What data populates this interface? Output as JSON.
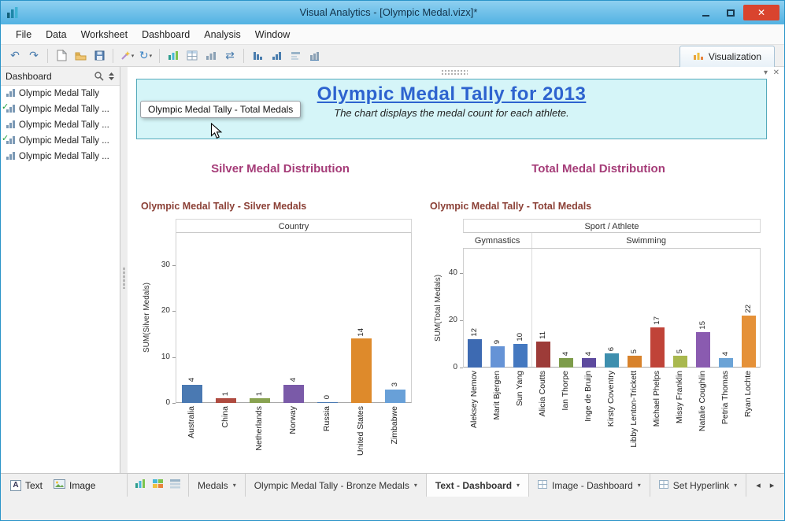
{
  "window": {
    "title": "Visual Analytics - [Olympic Medal.vizx]*"
  },
  "menubar": {
    "items": [
      "File",
      "Data",
      "Worksheet",
      "Dashboard",
      "Analysis",
      "Window"
    ]
  },
  "toolbar": {
    "visualization_tab": "Visualization"
  },
  "sidebar": {
    "header": "Dashboard",
    "items": [
      {
        "label": "Olympic Medal Tally",
        "checked": false
      },
      {
        "label": "Olympic Medal Tally ...",
        "checked": true
      },
      {
        "label": "Olympic Medal Tally ...",
        "checked": false
      },
      {
        "label": "Olympic Medal Tally ...",
        "checked": true
      },
      {
        "label": "Olympic Medal Tally ...",
        "checked": false
      }
    ],
    "footer": {
      "text": "Text",
      "image": "Image"
    }
  },
  "banner": {
    "title": "Olympic Medal Tally for 2013",
    "subtitle": "The chart displays the medal count for each athlete."
  },
  "tooltip": {
    "text": "Olympic Medal Tally - Total Medals"
  },
  "sections": {
    "left_heading": "Silver Medal Distribution",
    "right_heading": "Total Medal Distribution"
  },
  "chart_data": [
    {
      "type": "bar",
      "title": "Olympic Medal Tally - Silver Medals",
      "column_header": "Country",
      "ylabel": "SUM(Silver Medals)",
      "yticks": [
        0,
        10,
        20,
        30
      ],
      "ylim": [
        0,
        37
      ],
      "categories": [
        "Australia",
        "China",
        "Netherlands",
        "Norway",
        "Russia",
        "United States",
        "Zimbabwe"
      ],
      "values": [
        4,
        1,
        1,
        4,
        0,
        14,
        3
      ],
      "bar_colors": [
        "#4a79b2",
        "#af4b40",
        "#89a351",
        "#7a5aa8",
        "#4a79b2",
        "#de8a2b",
        "#68a0d8"
      ],
      "show_value_labels": true,
      "grid": false,
      "legend": "none"
    },
    {
      "type": "bar",
      "title": "Olympic Medal Tally - Total Medals",
      "column_header": "Sport / Athlete",
      "groups": [
        {
          "label": "Gymnastics",
          "span": 3
        },
        {
          "label": "Swimming",
          "span": 10
        }
      ],
      "ylabel": "SUM(Total Medals)",
      "yticks": [
        0,
        20,
        40
      ],
      "ylim": [
        0,
        50
      ],
      "categories": [
        "Aleksey Nemov",
        "Marit Bjergen",
        "Sun Yang",
        "Alicia Coutts",
        "Ian Thorpe",
        "Inge de Bruijn",
        "Kirsty Coventry",
        "Libby Lenton-Trickett",
        "Michael Phelps",
        "Missy Franklin",
        "Natalie Coughlin",
        "Petria Thomas",
        "Ryan Lochte"
      ],
      "values": [
        12,
        9,
        10,
        11,
        4,
        4,
        6,
        5,
        17,
        5,
        15,
        4,
        22
      ],
      "bar_colors": [
        "#3d6ab2",
        "#6593d6",
        "#4478c0",
        "#9d3b38",
        "#7d9c4a",
        "#5d4a9e",
        "#3e8fae",
        "#d8822b",
        "#c04338",
        "#a9b84e",
        "#8a5bb0",
        "#6ba3d6",
        "#e59138"
      ],
      "show_value_labels": true,
      "grid": false,
      "legend": "none"
    }
  ],
  "bottom_tabs": {
    "tabs": [
      {
        "label": "Medals"
      },
      {
        "label": "Olympic Medal Tally - Bronze Medals"
      },
      {
        "label": "Text - Dashboard"
      },
      {
        "label": "Image - Dashboard"
      },
      {
        "label": "Set Hyperlink"
      }
    ],
    "active_index": 2
  },
  "colors": {
    "section_heading": "#a53c78",
    "chart_title": "#8b4036",
    "banner_title": "#2d63cf",
    "banner_bg": "#d5f5f8",
    "banner_border": "#55aabb"
  }
}
